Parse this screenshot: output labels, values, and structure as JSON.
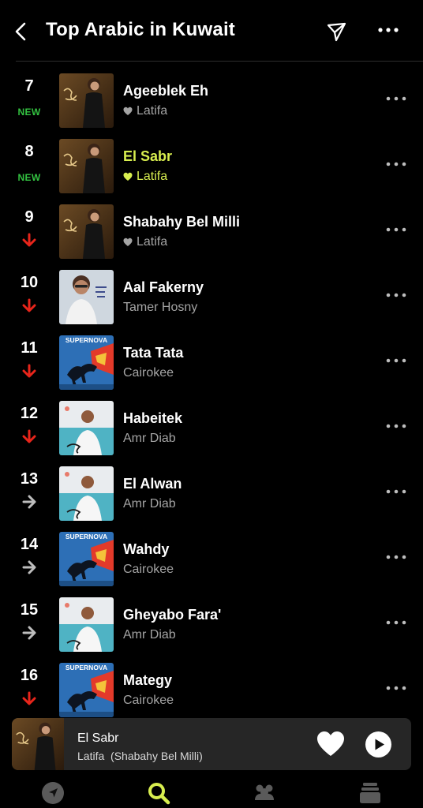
{
  "header": {
    "title": "Top Arabic in Kuwait",
    "back_icon": "chevron-left-icon",
    "share_icon": "paper-plane-icon",
    "more_icon": "more-horizontal-icon"
  },
  "colors": {
    "accent": "#d8ee4f",
    "new_badge": "#33c241",
    "trend_down": "#e8251b",
    "trend_same": "#bdbdbd",
    "background": "#000000",
    "muted_text": "#a4a4a4"
  },
  "songs": [
    {
      "rank": "7",
      "status": "new",
      "badge": "NEW",
      "title": "Ageeblek Eh",
      "artist": "Latifa",
      "liked": true,
      "art": "latifa",
      "active": false
    },
    {
      "rank": "8",
      "status": "new",
      "badge": "NEW",
      "title": "El Sabr",
      "artist": "Latifa",
      "liked": true,
      "art": "latifa",
      "active": true
    },
    {
      "rank": "9",
      "status": "down",
      "badge": "",
      "title": "Shabahy Bel Milli",
      "artist": "Latifa",
      "liked": true,
      "art": "latifa",
      "active": false
    },
    {
      "rank": "10",
      "status": "down",
      "badge": "",
      "title": "Aal Fakerny",
      "artist": "Tamer Hosny",
      "liked": false,
      "art": "tamer",
      "active": false
    },
    {
      "rank": "11",
      "status": "down",
      "badge": "",
      "title": "Tata Tata",
      "artist": "Cairokee",
      "liked": false,
      "art": "supernova",
      "active": false
    },
    {
      "rank": "12",
      "status": "down",
      "badge": "",
      "title": "Habeitek",
      "artist": "Amr Diab",
      "liked": false,
      "art": "amr",
      "active": false
    },
    {
      "rank": "13",
      "status": "same",
      "badge": "",
      "title": "El Alwan",
      "artist": "Amr Diab",
      "liked": false,
      "art": "amr",
      "active": false
    },
    {
      "rank": "14",
      "status": "same",
      "badge": "",
      "title": "Wahdy",
      "artist": "Cairokee",
      "liked": false,
      "art": "supernova",
      "active": false
    },
    {
      "rank": "15",
      "status": "same",
      "badge": "",
      "title": "Gheyabo Fara'",
      "artist": "Amr Diab",
      "liked": false,
      "art": "amr",
      "active": false
    },
    {
      "rank": "16",
      "status": "down",
      "badge": "",
      "title": "Mategy",
      "artist": "Cairokee",
      "liked": false,
      "art": "supernova",
      "active": false
    }
  ],
  "art_text": {
    "supernova": "SUPERNOVA"
  },
  "mini_player": {
    "title": "El Sabr",
    "subtitle": "Latifa  (Shabahy Bel Milli)",
    "liked": true,
    "heart_icon": "heart-filled-icon",
    "play_icon": "play-icon"
  },
  "tabs": [
    {
      "name": "explore",
      "icon": "compass-arrow-icon",
      "active": false
    },
    {
      "name": "search",
      "icon": "search-icon",
      "active": true
    },
    {
      "name": "friends",
      "icon": "friends-icon",
      "active": false
    },
    {
      "name": "library",
      "icon": "library-stack-icon",
      "active": false
    }
  ]
}
